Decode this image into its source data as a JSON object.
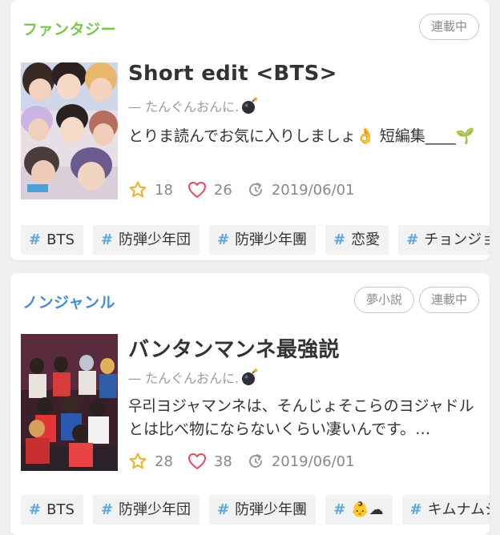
{
  "cards": [
    {
      "genre": "ファンタジー",
      "genre_color": "#7ac943",
      "badges": [
        "連載中"
      ],
      "title": "Short edit <BTS>",
      "author": "— たんぐんおんに.",
      "description": "とりま読んでお気に入りしましょ👌 短編集____🌱",
      "stars": "18",
      "likes": "26",
      "updated": "2019/06/01",
      "tags": [
        "BTS",
        "防弾少年団",
        "防弾少年團",
        "恋愛",
        "チョンジョン"
      ]
    },
    {
      "genre": "ノンジャンル",
      "genre_color": "#3e8ede",
      "badges": [
        "夢小説",
        "連載中"
      ],
      "title": "バンタンマンネ最強説",
      "author": "— たんぐんおんに.",
      "description": "우리ヨジャマンネは、そんじょそこらのヨジャドルとは比べ物にならないくらい凄いんです。…",
      "stars": "28",
      "likes": "38",
      "updated": "2019/06/01",
      "tags": [
        "BTS",
        "防弾少年団",
        "防弾少年團",
        "👶☁",
        "キムナムジュン"
      ]
    }
  ],
  "icons": {
    "star": "star-icon",
    "heart": "heart-icon",
    "updated": "refresh-icon",
    "bomb": "bomb-icon",
    "hash": "#"
  },
  "colors": {
    "star": "#f2b01e",
    "heart": "#e8475a",
    "hash": "#5aa7e0"
  }
}
